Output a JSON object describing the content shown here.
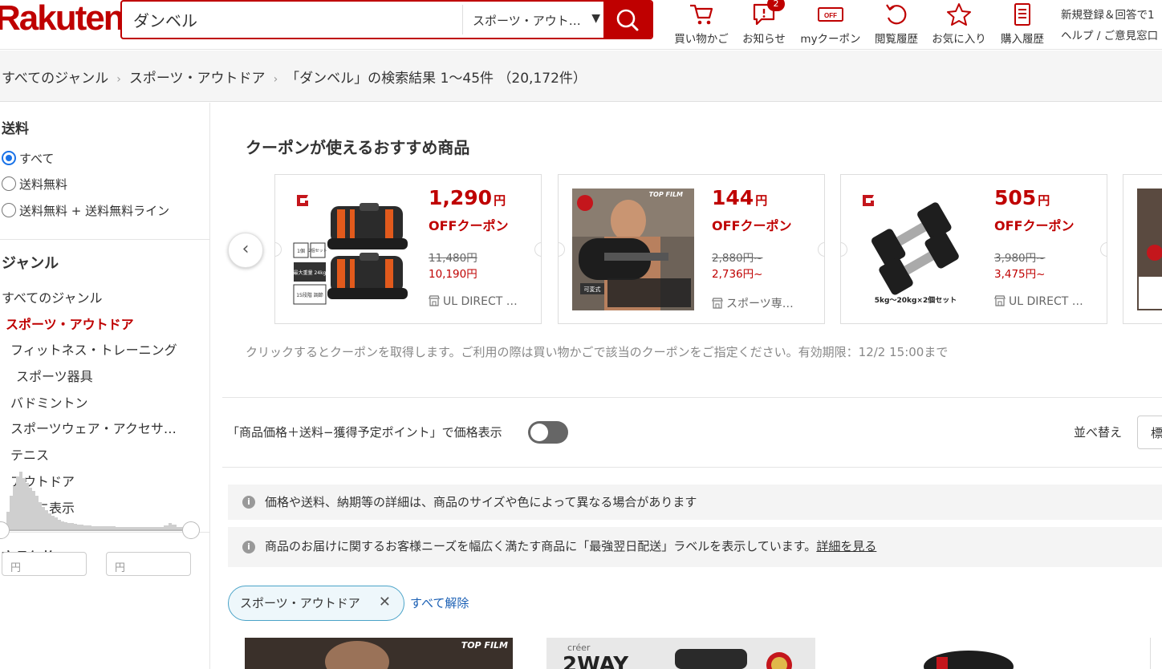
{
  "header": {
    "logo": "Rakuten",
    "search_value": "ダンベル",
    "search_genre": "スポーツ・アウト…",
    "nav": [
      {
        "label": "買い物かご",
        "icon": "cart-icon"
      },
      {
        "label": "お知らせ",
        "icon": "notification-icon",
        "badge": "2"
      },
      {
        "label": "myクーポン",
        "icon": "coupon-icon"
      },
      {
        "label": "閲覧履歴",
        "icon": "history-icon"
      },
      {
        "label": "お気に入り",
        "icon": "star-icon"
      },
      {
        "label": "購入履歴",
        "icon": "receipt-icon"
      }
    ],
    "register": "新規登録＆回答で1",
    "help": "ヘルプ / ご意見窓口"
  },
  "breadcrumb": {
    "items": [
      "すべてのジャンル",
      "スポーツ・アウトドア"
    ],
    "result": "「ダンベル」の検索結果 1～45件 （20,172件）"
  },
  "sidebar": {
    "shipping_title": "送料",
    "shipping_options": [
      "すべて",
      "送料無料",
      "送料無料 + 送料無料ライン"
    ],
    "genre_title": "ジャンル",
    "genres": [
      {
        "label": "すべてのジャンル"
      },
      {
        "label": "スポーツ・アウトドア"
      },
      {
        "label": "フィットネス・トレーニング"
      },
      {
        "label": "スポーツ器具"
      },
      {
        "label": "バドミントン"
      },
      {
        "label": "スポーツウェア・アクセサ…"
      },
      {
        "label": "テニス"
      },
      {
        "label": "アウトドア"
      },
      {
        "label": "さらに表示"
      }
    ],
    "price_title": "商品価格",
    "price_min_placeholder": "円",
    "price_max_placeholder": "円"
  },
  "coupons": {
    "title": "クーポンが使えるおすすめ商品",
    "yen": "円",
    "off_label": "OFFクーポン",
    "items": [
      {
        "amount": "1,290",
        "orig": "11,480円",
        "now": "10,190円",
        "shop": "UL DIRECT …"
      },
      {
        "amount": "144",
        "orig": "2,880円~",
        "now": "2,736円~",
        "shop": "スポーツ専…"
      },
      {
        "amount": "505",
        "orig": "3,980円~",
        "now": "3,475円~",
        "shop": "UL DIRECT …"
      }
    ],
    "note": "クリックするとクーポンを取得します。ご利用の際は買い物かごで該当のクーポンをご指定ください。有効期限：12/2 15:00まで"
  },
  "controls": {
    "toggle_label": "「商品価格＋送料−獲得予定ポイント」で価格表示",
    "sort_label": "並べ替え",
    "sort_value": "標"
  },
  "notices": [
    {
      "text": "価格や送料、納期等の詳細は、商品のサイズや色によって異なる場合があります",
      "link": ""
    },
    {
      "text": "商品のお届けに関するお客様ニーズを幅広く満たす商品に「最強翌日配送」ラベルを表示しています。",
      "link": "詳細を見る"
    }
  ],
  "filters": {
    "chip": "スポーツ・アウトドア",
    "clear_all": "すべて解除"
  },
  "thumb_texts": {
    "card1_tag1": "1個",
    "card1_tag2": "2個セット",
    "card1_tag3": "最大重量 24kg",
    "card1_tag4": "15段階 調節",
    "card2_top": "TOP FILM",
    "card2_badge": "可変式",
    "card3_caption": "5kg〜20kg×2個セット",
    "product1_brand": "TOP FILM",
    "product2_brand": "créer",
    "product2_text": "2WAY"
  },
  "colors": {
    "brand": "#bf0000",
    "link": "#1a5fb4"
  }
}
